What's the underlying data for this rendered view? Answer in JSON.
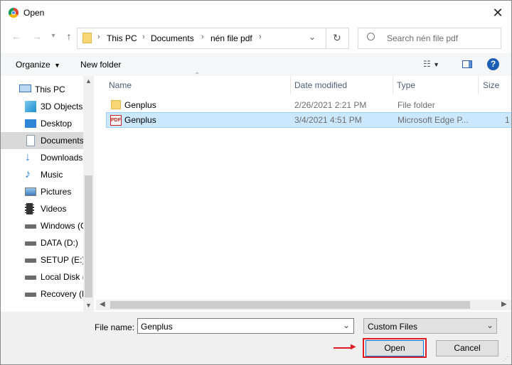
{
  "window": {
    "title": "Open",
    "close": "✕"
  },
  "breadcrumb": {
    "items": [
      "This PC",
      "Documents",
      "nén file pdf"
    ]
  },
  "search": {
    "placeholder": "Search nén file pdf"
  },
  "toolbar": {
    "organize_label": "Organize",
    "new_folder_label": "New folder"
  },
  "sidebar": {
    "items": [
      {
        "label": "This PC",
        "icon": "computer-icon"
      },
      {
        "label": "3D Objects",
        "icon": "cube-icon"
      },
      {
        "label": "Desktop",
        "icon": "desktop-icon"
      },
      {
        "label": "Documents",
        "icon": "documents-icon",
        "selected": true
      },
      {
        "label": "Downloads",
        "icon": "download-icon"
      },
      {
        "label": "Music",
        "icon": "music-icon"
      },
      {
        "label": "Pictures",
        "icon": "pictures-icon"
      },
      {
        "label": "Videos",
        "icon": "videos-icon"
      },
      {
        "label": "Windows (C",
        "icon": "drive-icon"
      },
      {
        "label": "DATA (D:)",
        "icon": "drive-icon"
      },
      {
        "label": "SETUP (E:)",
        "icon": "drive-icon"
      },
      {
        "label": "Local Disk (",
        "icon": "drive-icon"
      },
      {
        "label": "Recovery (H",
        "icon": "drive-icon"
      }
    ]
  },
  "file_list": {
    "columns": [
      "Name",
      "Date modified",
      "Type",
      "Size"
    ],
    "rows": [
      {
        "name": "Genplus",
        "date": "2/26/2021 2:21 PM",
        "type": "File folder",
        "size": "",
        "icon": "folder-icon"
      },
      {
        "name": "Genplus",
        "date": "3/4/2021 4:51 PM",
        "type": "Microsoft Edge P...",
        "size": "1",
        "icon": "pdf-icon",
        "selected": true
      }
    ]
  },
  "footer": {
    "file_name_label": "File name:",
    "file_name_value": "Genplus",
    "file_type_value": "Custom Files",
    "open_label": "Open",
    "cancel_label": "Cancel"
  },
  "colors": {
    "selection": "#cce8ff",
    "accent_red": "#e01b24",
    "help_blue": "#1a5fb4"
  }
}
